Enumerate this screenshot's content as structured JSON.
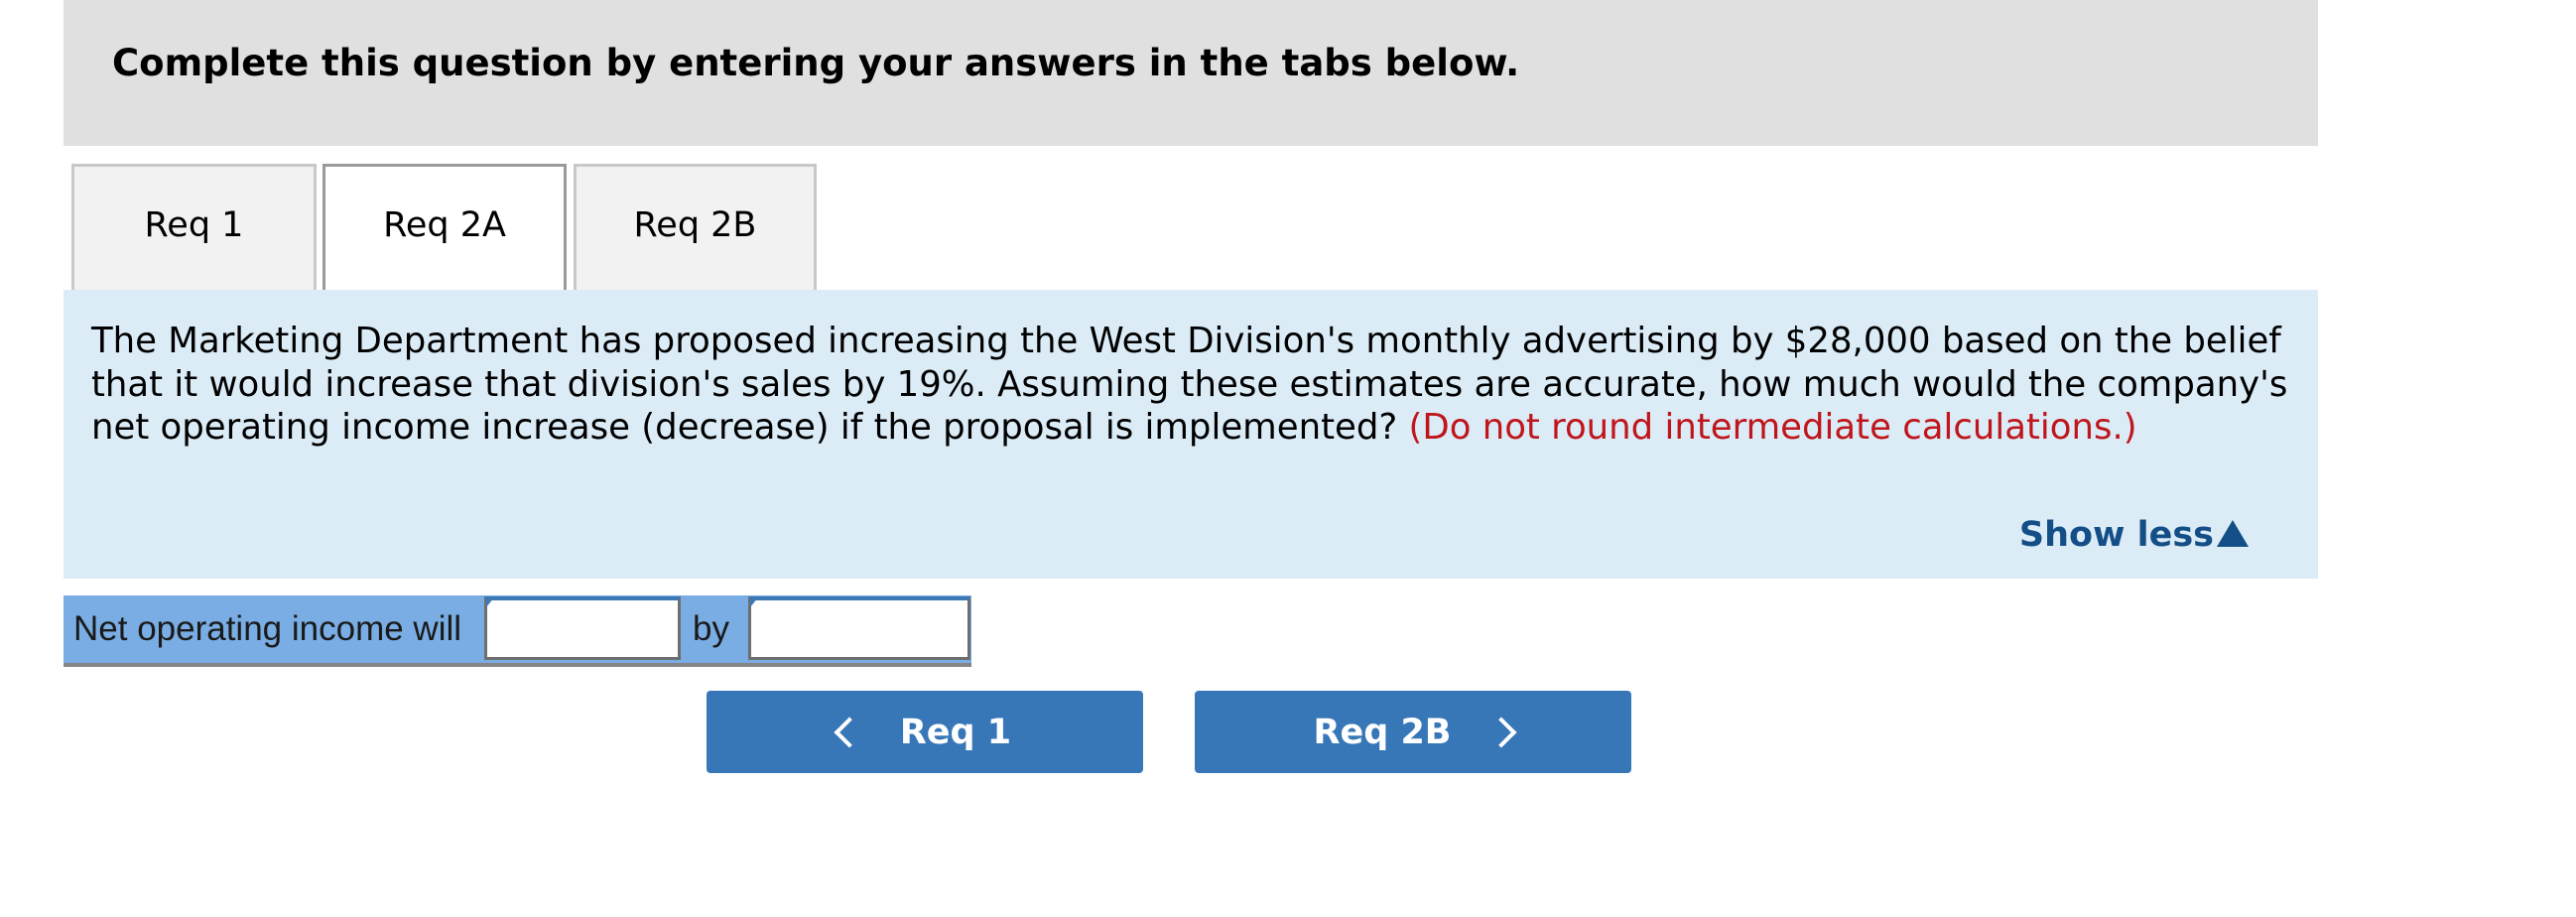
{
  "header": {
    "title": "Complete this question by entering your answers in the tabs below."
  },
  "tabs": [
    {
      "label": "Req 1",
      "active": false
    },
    {
      "label": "Req 2A",
      "active": true
    },
    {
      "label": "Req 2B",
      "active": false
    }
  ],
  "question": {
    "text": "The Marketing Department has proposed increasing the West Division's monthly advertising by $28,000 based on the belief that it would increase that division's sales by 19%. Assuming these estimates are accurate, how much would the company's net operating income increase (decrease) if the proposal is implemented? ",
    "note": "(Do not round intermediate calculations.)",
    "show_less_label": "Show less",
    "show_less_icon": "triangle-up-icon"
  },
  "answer_row": {
    "label": "Net operating income will",
    "direction_value": "",
    "by_label": "by",
    "amount_value": ""
  },
  "nav": {
    "prev_label": "Req 1",
    "prev_icon": "chevron-left-icon",
    "next_label": "Req 2B",
    "next_icon": "chevron-right-icon"
  },
  "colors": {
    "header_bg": "#e0e0e0",
    "panel_bg": "#dbecf7",
    "note_red": "#c0151b",
    "link_blue": "#144e86",
    "answer_row_bg": "#79ade3",
    "button_blue": "#3777b8"
  }
}
